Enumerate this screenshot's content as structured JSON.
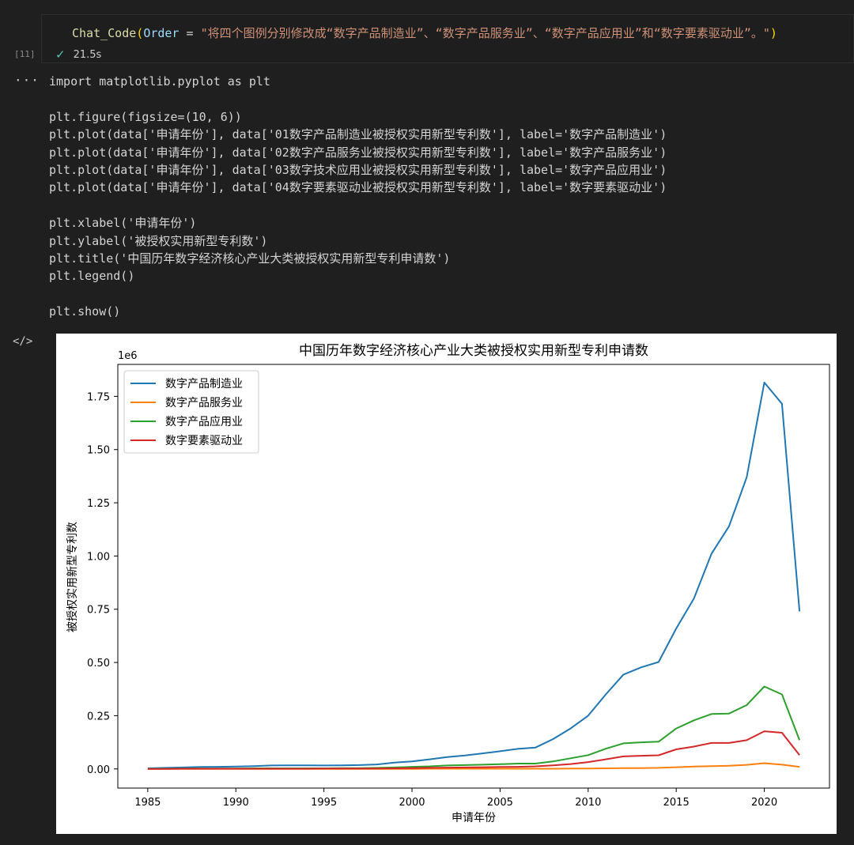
{
  "prompt_cell": {
    "fn": "Chat_Code",
    "param": "Order",
    "op": " = ",
    "string": "\"将四个图例分别修改成“数字产品制造业”、“数字产品服务业”、“数字产品应用业”和“数字要素驱动业”。\"",
    "exec_count": "[11]",
    "duration": "21.5s"
  },
  "code_lines": [
    "import matplotlib.pyplot as plt",
    "",
    "plt.figure(figsize=(10, 6))",
    "plt.plot(data['申请年份'], data['01数字产品制造业被授权实用新型专利数'], label='数字产品制造业')",
    "plt.plot(data['申请年份'], data['02数字产品服务业被授权实用新型专利数'], label='数字产品服务业')",
    "plt.plot(data['申请年份'], data['03数字技术应用业被授权实用新型专利数'], label='数字产品应用业')",
    "plt.plot(data['申请年份'], data['04数字要素驱动业被授权实用新型专利数'], label='数字要素驱动业')",
    "",
    "plt.xlabel('申请年份')",
    "plt.ylabel('被授权实用新型专利数')",
    "plt.title('中国历年数字经济核心产业大类被授权实用新型专利申请数')",
    "plt.legend()",
    "",
    "plt.show()"
  ],
  "chart_data": {
    "type": "line",
    "title": "中国历年数字经济核心产业大类被授权实用新型专利申请数",
    "xlabel": "申请年份",
    "ylabel": "被授权实用新型专利数",
    "offset_label": "1e6",
    "xlim": [
      1983.3,
      2023.7
    ],
    "ylim": [
      -0.09,
      1.9
    ],
    "xticks": [
      1985,
      1990,
      1995,
      2000,
      2005,
      2010,
      2015,
      2020
    ],
    "xtick_labels": [
      "1985",
      "1990",
      "1995",
      "2000",
      "2005",
      "2010",
      "2015",
      "2020"
    ],
    "yticks": [
      0,
      0.25,
      0.5,
      0.75,
      1.0,
      1.25,
      1.5,
      1.75
    ],
    "ytick_labels": [
      "0.00",
      "0.25",
      "0.50",
      "0.75",
      "1.00",
      "1.25",
      "1.50",
      "1.75"
    ],
    "legend_position": "upper-left",
    "x": [
      1985,
      1986,
      1987,
      1988,
      1989,
      1990,
      1991,
      1992,
      1993,
      1994,
      1995,
      1996,
      1997,
      1998,
      1999,
      2000,
      2001,
      2002,
      2003,
      2004,
      2005,
      2006,
      2007,
      2008,
      2009,
      2010,
      2011,
      2012,
      2013,
      2014,
      2015,
      2016,
      2017,
      2018,
      2019,
      2020,
      2021,
      2022
    ],
    "series": [
      {
        "name": "数字产品制造业",
        "color": "#1f77b4",
        "values": [
          0.003,
          0.005,
          0.007,
          0.009,
          0.01,
          0.011,
          0.013,
          0.016,
          0.017,
          0.017,
          0.016,
          0.017,
          0.018,
          0.021,
          0.03,
          0.035,
          0.045,
          0.056,
          0.063,
          0.073,
          0.083,
          0.094,
          0.1,
          0.14,
          0.19,
          0.25,
          0.35,
          0.443,
          0.477,
          0.502,
          0.66,
          0.8,
          1.01,
          1.14,
          1.37,
          1.815,
          1.715,
          0.74
        ]
      },
      {
        "name": "数字产品服务业",
        "color": "#ff7f0e",
        "values": [
          0.0,
          0.0,
          0.0,
          0.0,
          0.0,
          0.0,
          0.0,
          0.0,
          0.0,
          0.0,
          0.0,
          0.0,
          0.0,
          0.0,
          0.0,
          0.0,
          0.001,
          0.001,
          0.001,
          0.001,
          0.001,
          0.001,
          0.001,
          0.001,
          0.002,
          0.002,
          0.003,
          0.004,
          0.004,
          0.005,
          0.008,
          0.011,
          0.013,
          0.015,
          0.019,
          0.027,
          0.02,
          0.01
        ]
      },
      {
        "name": "数字产品应用业",
        "color": "#2ca02c",
        "values": [
          0.001,
          0.001,
          0.002,
          0.002,
          0.002,
          0.002,
          0.003,
          0.003,
          0.003,
          0.003,
          0.003,
          0.004,
          0.004,
          0.005,
          0.007,
          0.01,
          0.012,
          0.016,
          0.018,
          0.02,
          0.022,
          0.025,
          0.025,
          0.035,
          0.05,
          0.065,
          0.095,
          0.12,
          0.125,
          0.128,
          0.19,
          0.228,
          0.258,
          0.26,
          0.3,
          0.387,
          0.35,
          0.135
        ]
      },
      {
        "name": "数字要素驱动业",
        "color": "#d62728",
        "values": [
          0.0,
          0.0,
          0.001,
          0.001,
          0.001,
          0.001,
          0.001,
          0.001,
          0.001,
          0.001,
          0.002,
          0.002,
          0.002,
          0.002,
          0.003,
          0.004,
          0.005,
          0.006,
          0.007,
          0.008,
          0.009,
          0.01,
          0.012,
          0.017,
          0.023,
          0.032,
          0.045,
          0.059,
          0.062,
          0.064,
          0.092,
          0.105,
          0.122,
          0.122,
          0.135,
          0.177,
          0.17,
          0.065
        ]
      }
    ]
  }
}
